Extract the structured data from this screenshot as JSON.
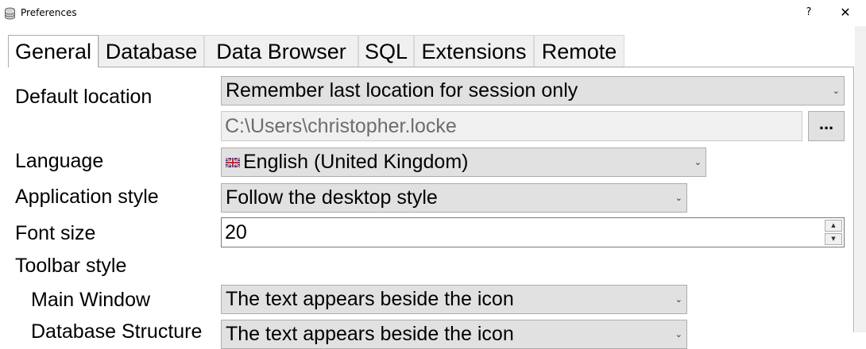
{
  "window": {
    "title": "Preferences",
    "help_label": "?",
    "close_label": "✕"
  },
  "tabs": [
    {
      "label": "General",
      "active": true
    },
    {
      "label": "Database",
      "active": false
    },
    {
      "label": "Data Browser",
      "active": false
    },
    {
      "label": "SQL",
      "active": false
    },
    {
      "label": "Extensions",
      "active": false
    },
    {
      "label": "Remote",
      "active": false
    }
  ],
  "general": {
    "default_location": {
      "label": "Default location",
      "value": "Remember last location for session only",
      "path": "C:\\Users\\christopher.locke",
      "browse_label": "..."
    },
    "language": {
      "label": "Language",
      "value": "English (United Kingdom)",
      "flag_icon": "uk-flag-icon"
    },
    "app_style": {
      "label": "Application style",
      "value": "Follow the desktop style"
    },
    "font_size": {
      "label": "Font size",
      "value": "20"
    },
    "toolbar_style": {
      "label": "Toolbar style",
      "main_window": {
        "label": "Main Window",
        "value": "The text appears beside the icon"
      },
      "database_structure": {
        "label": "Database Structure",
        "value": "The text appears beside the icon"
      }
    }
  },
  "icons": {
    "dropdown_arrow": "chevron-down-icon",
    "spin_up": "spin-up-icon",
    "spin_down": "spin-down-icon"
  },
  "colors": {
    "combo_bg": "#e1e1e1",
    "combo_border": "#adadad",
    "tab_inactive_bg": "#f0f0f0"
  }
}
